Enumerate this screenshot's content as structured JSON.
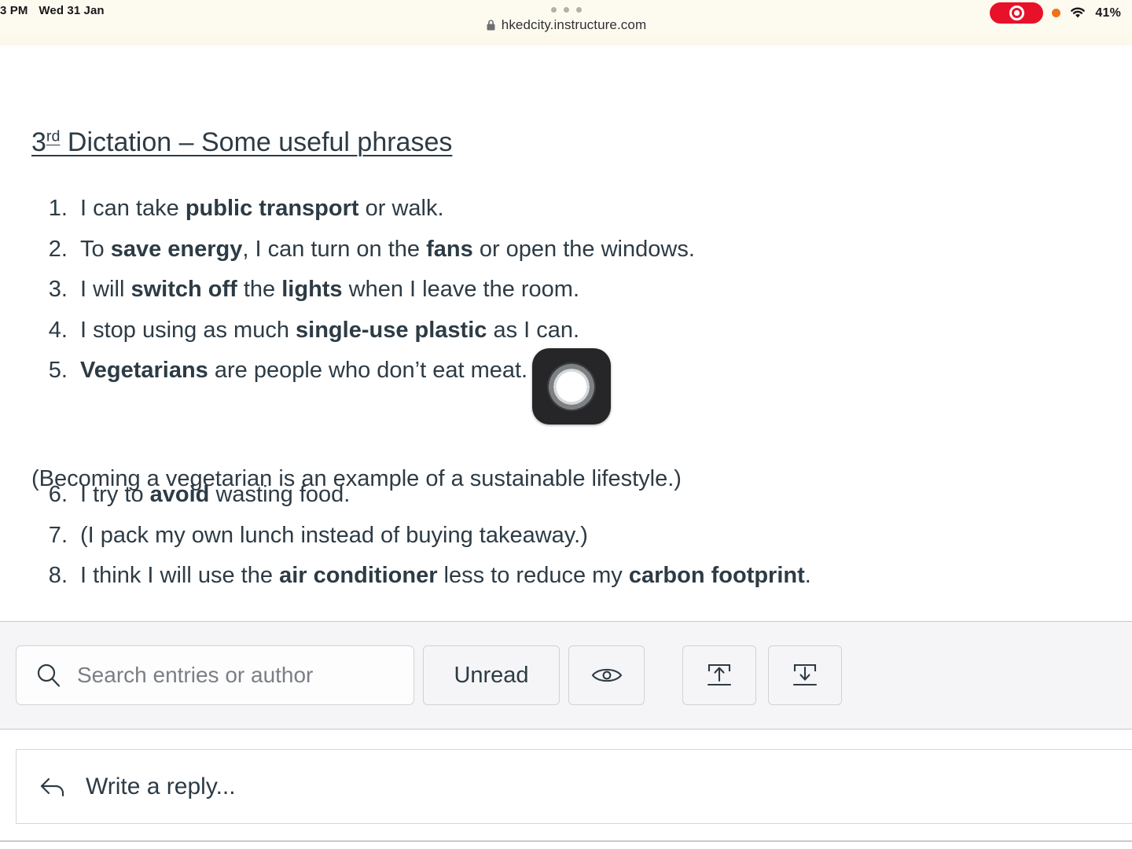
{
  "status_bar": {
    "time": "3 PM",
    "date": "Wed 31 Jan",
    "record_icon": "record-circle-icon",
    "orange_indicator": "orange-dot-indicator",
    "wifi_icon": "wifi-icon",
    "battery": "41%",
    "accent_red": "#e8112a",
    "accent_orange": "#f07118",
    "bar_background": "#fdfbf0"
  },
  "browser": {
    "tab_dots": "three-dots-icon",
    "lock_icon": "lock-icon",
    "url": "hkedcity.instructure.com"
  },
  "document": {
    "title_prefix": "3",
    "title_sup": "rd",
    "title_rest": " Dictation  – Some useful phrases",
    "text_color": "#2d3b45",
    "items": [
      {
        "number": "1.",
        "parts": [
          {
            "text": "I can take ",
            "bold": false
          },
          {
            "text": "public transport",
            "bold": true
          },
          {
            "text": " or walk.",
            "bold": false
          }
        ]
      },
      {
        "number": "2.",
        "parts": [
          {
            "text": "To ",
            "bold": false
          },
          {
            "text": "save energy",
            "bold": true
          },
          {
            "text": ", I can turn on the ",
            "bold": false
          },
          {
            "text": "fans",
            "bold": true
          },
          {
            "text": " or open the windows.",
            "bold": false
          }
        ]
      },
      {
        "number": "3.",
        "parts": [
          {
            "text": "I will ",
            "bold": false
          },
          {
            "text": "switch off",
            "bold": true
          },
          {
            "text": " the ",
            "bold": false
          },
          {
            "text": "lights",
            "bold": true
          },
          {
            "text": " when I leave the room.",
            "bold": false
          }
        ]
      },
      {
        "number": "4.",
        "parts": [
          {
            "text": "I stop using as much ",
            "bold": false
          },
          {
            "text": "single-use plastic",
            "bold": true
          },
          {
            "text": " as I can.",
            "bold": false
          }
        ]
      },
      {
        "number": "5.",
        "parts": [
          {
            "text": "Vegetarians",
            "bold": true
          },
          {
            "text": " are people who don’t eat meat.",
            "bold": false
          }
        ]
      }
    ],
    "note_1": "(Becoming a vegetarian is an example of a sustainable lifestyle.)",
    "items_2": [
      {
        "number": "6.",
        "parts": [
          {
            "text": "I try to ",
            "bold": false
          },
          {
            "text": "avoid",
            "bold": true
          },
          {
            "text": " wasting food.",
            "bold": false
          }
        ]
      }
    ],
    "note_2": "(I pack my own lunch instead of buying takeaway.)",
    "items_3": [
      {
        "number": "7.",
        "parts": [
          {
            "text": "I think I will use the ",
            "bold": false
          },
          {
            "text": "air conditioner",
            "bold": true
          },
          {
            "text": " less to reduce my ",
            "bold": false
          },
          {
            "text": "carbon footprint",
            "bold": true
          },
          {
            "text": ".",
            "bold": false
          }
        ]
      }
    ]
  },
  "overlay": {
    "name": "camera-lens-overlay",
    "background": "#262628"
  },
  "toolbar": {
    "search_placeholder": "Search entries or author",
    "search_value": "",
    "search_icon": "search-icon",
    "unread_label": "Unread",
    "eye_icon": "eye-icon",
    "collapse_icon": "collapse-up-icon",
    "expand_icon": "expand-down-icon",
    "background": "#f5f4f7"
  },
  "reply": {
    "placeholder": "Write a reply...",
    "icon": "reply-arrow-icon"
  }
}
